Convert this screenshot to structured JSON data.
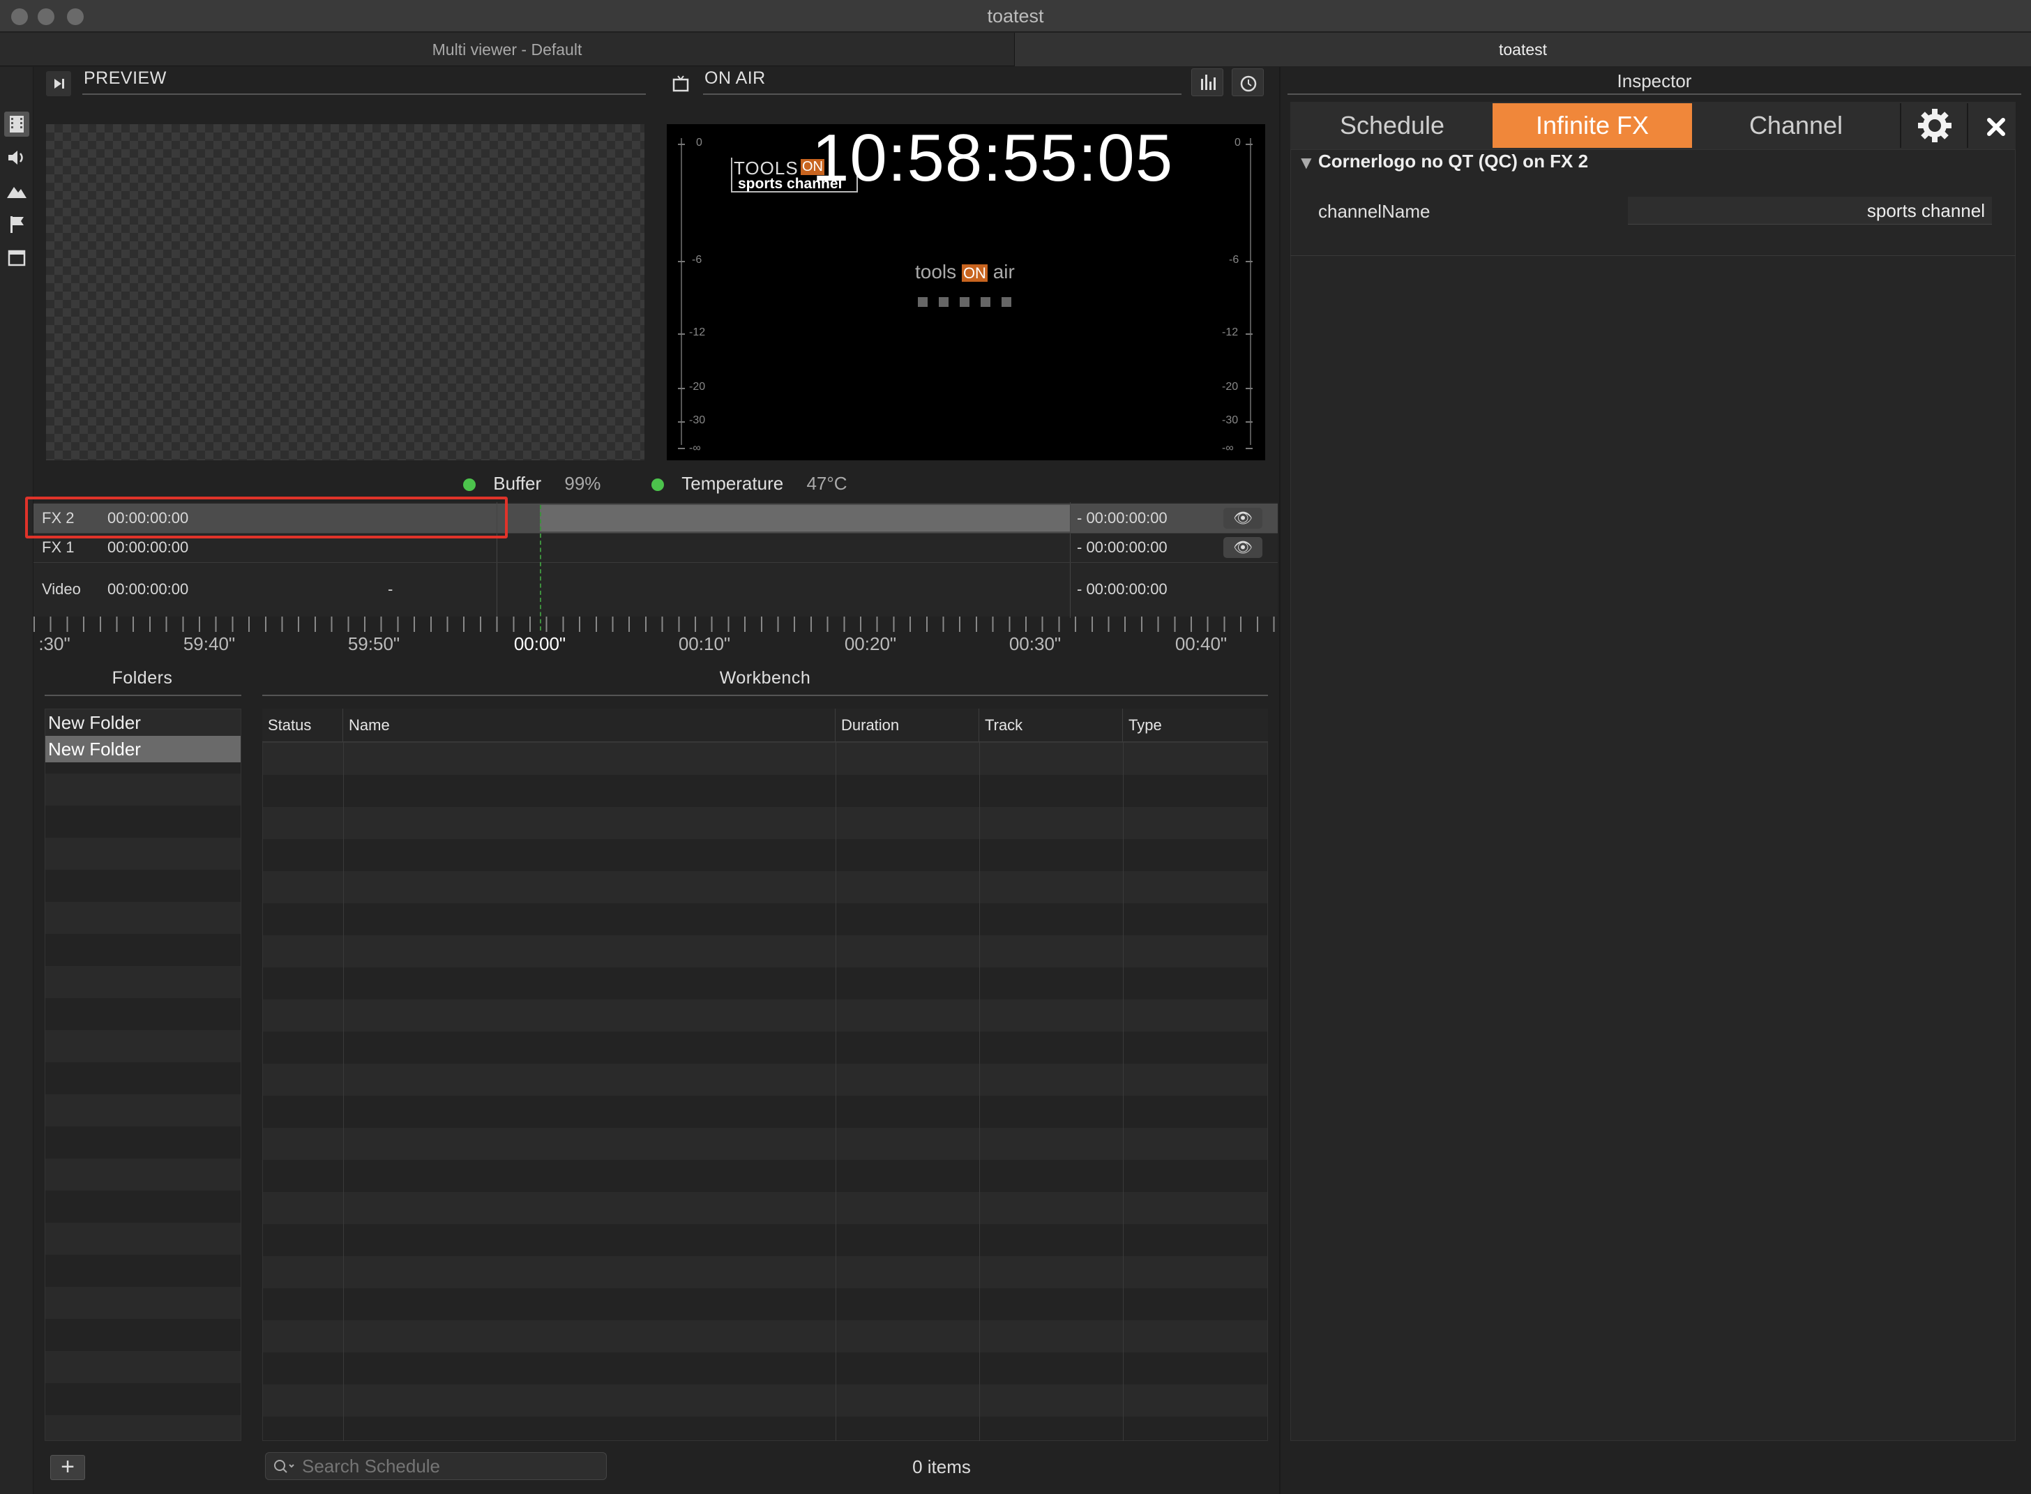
{
  "window": {
    "title": "toatest"
  },
  "tabs": [
    {
      "label": "Multi viewer - Default"
    },
    {
      "label": "toatest"
    }
  ],
  "preview": {
    "label": "PREVIEW"
  },
  "onair": {
    "label": "ON AIR",
    "timecode": "10:58:55:05",
    "logo_top": "TOOLS",
    "logo_on": "ON",
    "logo_bottom": "sports channel",
    "center_logo_left": "tools",
    "center_logo_on": "ON",
    "center_logo_right": "air",
    "meter_labels": [
      "0",
      "-6",
      "-12",
      "-20",
      "-30",
      "-∞"
    ]
  },
  "status": {
    "buffer_label": "Buffer",
    "buffer_value": "99%",
    "temp_label": "Temperature",
    "temp_value": "47°C"
  },
  "tracks": [
    {
      "name": "FX 2",
      "timecode": "00:00:00:00",
      "extra": "",
      "remaining": "- 00:00:00:00"
    },
    {
      "name": "FX 1",
      "timecode": "00:00:00:00",
      "extra": "",
      "remaining": "- 00:00:00:00"
    },
    {
      "name": "Video",
      "timecode": "00:00:00:00",
      "extra": "-",
      "remaining": "- 00:00:00:00"
    }
  ],
  "ruler": {
    "labels": [
      ":30\"",
      "59:40\"",
      "59:50\"",
      "00:00\"",
      "00:10\"",
      "00:20\"",
      "00:30\"",
      "00:40\""
    ]
  },
  "folders": {
    "title": "Folders",
    "items": [
      {
        "label": "New Folder"
      },
      {
        "label": "New Folder"
      }
    ],
    "add_label": "+"
  },
  "workbench": {
    "title": "Workbench",
    "columns": [
      "Status",
      "Name",
      "Duration",
      "Track",
      "Type"
    ],
    "search_placeholder": "Search Schedule",
    "count": "0 items"
  },
  "inspector": {
    "title": "Inspector",
    "tabs": [
      {
        "label": "Schedule"
      },
      {
        "label": "Infinite FX"
      },
      {
        "label": "Channel"
      }
    ],
    "section": "Cornerlogo no QT (QC) on FX 2",
    "field_label": "channelName",
    "field_value": "sports channel"
  },
  "colors": {
    "accent": "#f0873a",
    "selection": "#e0332a",
    "status_ok": "#4cc34c"
  }
}
